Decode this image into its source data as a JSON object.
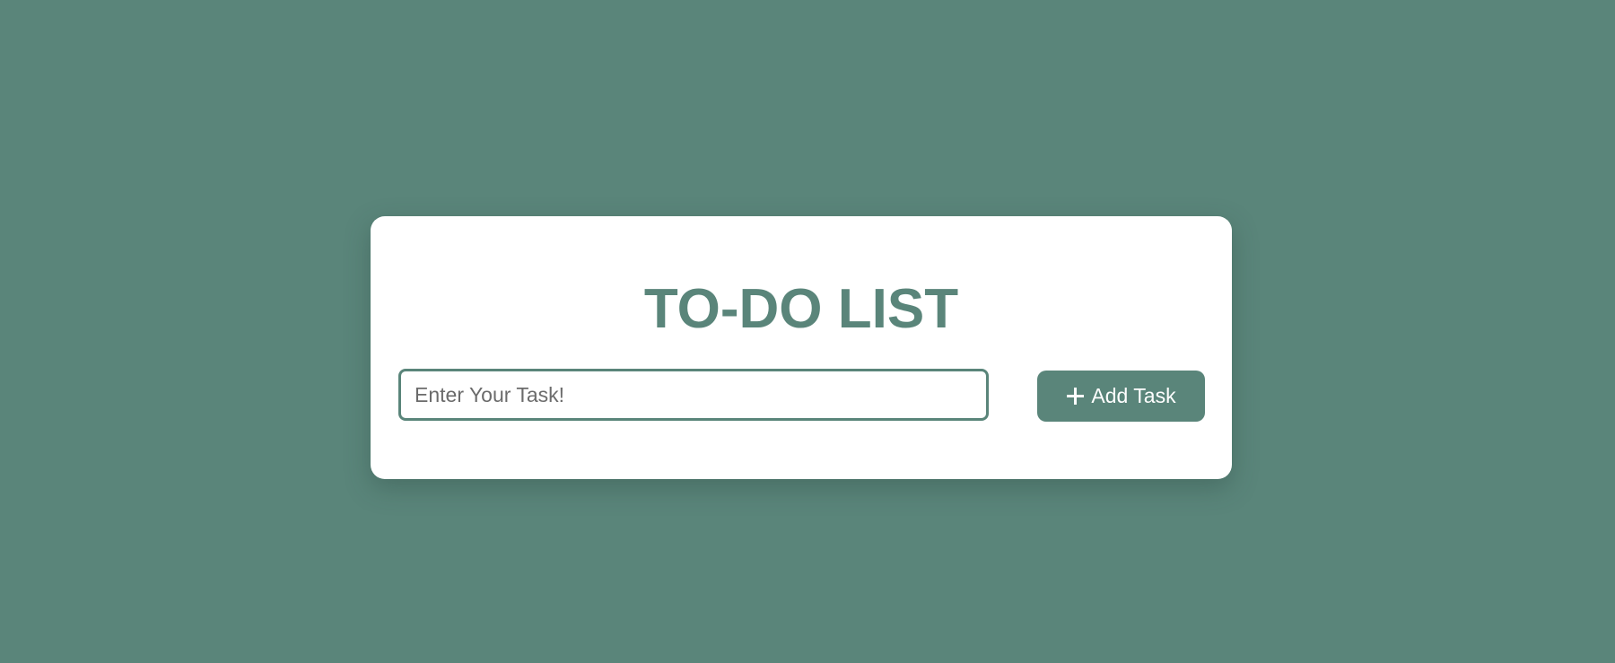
{
  "app": {
    "title": "TO-DO LIST"
  },
  "task_input": {
    "value": "",
    "placeholder": "Enter Your Task!"
  },
  "add_button": {
    "icon": "plus-icon",
    "label": "Add Task"
  },
  "colors": {
    "background": "#5a857a",
    "card": "#ffffff",
    "accent": "#5a857a",
    "button_text": "#ffffff"
  }
}
